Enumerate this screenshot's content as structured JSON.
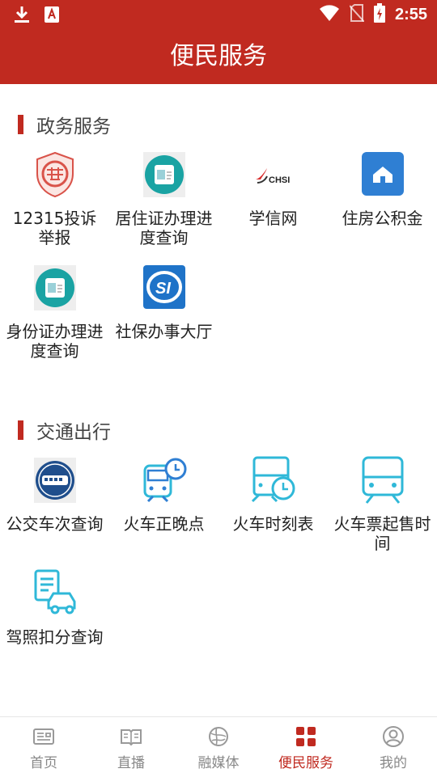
{
  "status_bar": {
    "time": "2:55"
  },
  "header": {
    "title": "便民服务"
  },
  "sections": [
    {
      "title": "政务服务",
      "items": [
        {
          "label": "12315投诉举报",
          "icon": "complaint-seal-icon"
        },
        {
          "label": "居住证办理进度查询",
          "icon": "id-card-icon"
        },
        {
          "label": "学信网",
          "icon": "chsi-logo-icon",
          "logo_text": "CHSI"
        },
        {
          "label": "住房公积金",
          "icon": "house-icon"
        },
        {
          "label": "身份证办理进度查询",
          "icon": "id-card-icon"
        },
        {
          "label": "社保办事大厅",
          "icon": "social-security-icon",
          "logo_text": "SI"
        }
      ]
    },
    {
      "title": "交通出行",
      "items": [
        {
          "label": "公交车次查询",
          "icon": "bus-icon"
        },
        {
          "label": "火车正晚点",
          "icon": "train-clock-icon"
        },
        {
          "label": "火车时刻表",
          "icon": "train-schedule-icon"
        },
        {
          "label": "火车票起售时间",
          "icon": "train-icon"
        },
        {
          "label": "驾照扣分查询",
          "icon": "car-license-icon"
        }
      ]
    }
  ],
  "tabs": [
    {
      "label": "首页",
      "icon": "news-icon",
      "active": false
    },
    {
      "label": "直播",
      "icon": "book-icon",
      "active": false
    },
    {
      "label": "融媒体",
      "icon": "globe-icon",
      "active": false
    },
    {
      "label": "便民服务",
      "icon": "grid-icon",
      "active": true
    },
    {
      "label": "我的",
      "icon": "user-icon",
      "active": false
    }
  ],
  "colors": {
    "brand": "#c02a20",
    "teal": "#1aa3a3",
    "blue": "#2f7fd3",
    "cyan": "#2fb8d8"
  }
}
